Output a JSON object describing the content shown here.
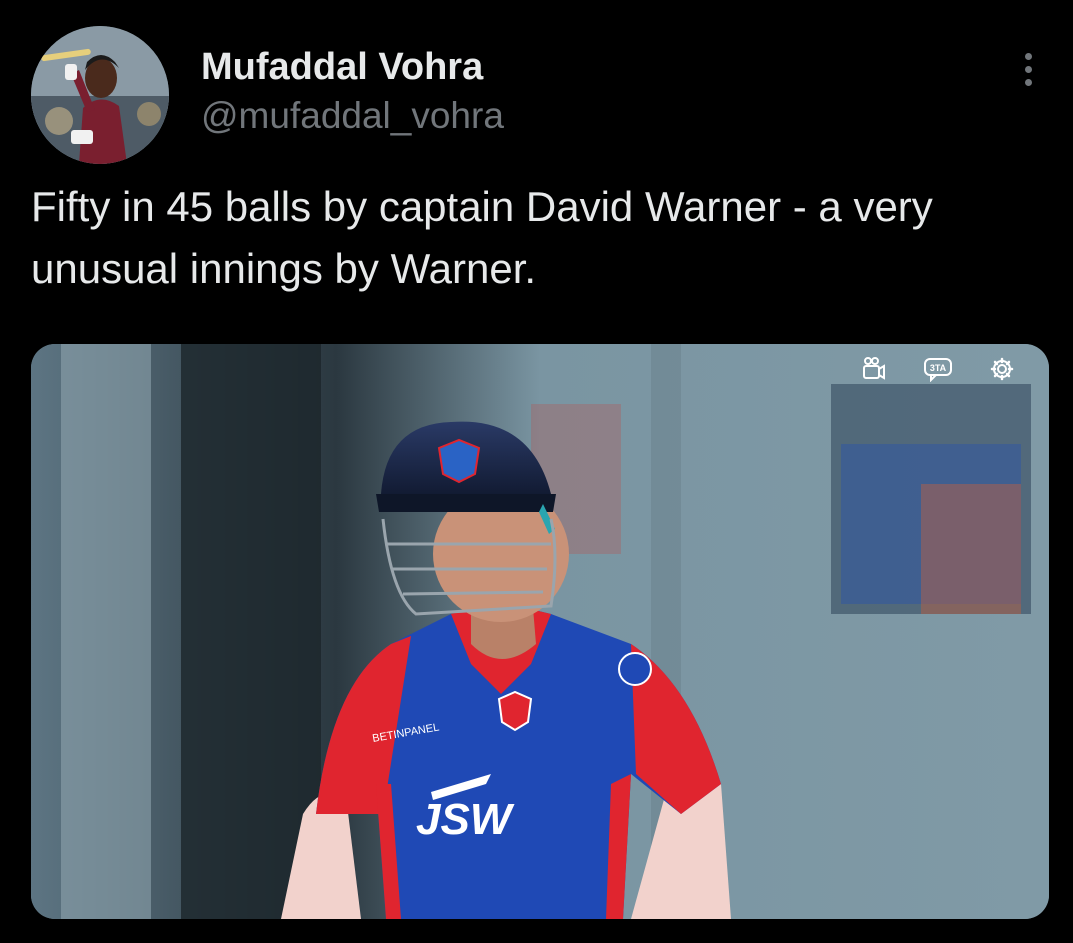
{
  "tweet": {
    "display_name": "Mufaddal Vohra",
    "handle": "@mufaddal_vohra",
    "text": "Fifty in 45 balls by captain David Warner - a very unusual innings by Warner."
  },
  "media": {
    "type": "video",
    "controls": [
      {
        "name": "video-camera-icon"
      },
      {
        "name": "caption-language-icon",
        "label": "3TA"
      },
      {
        "name": "settings-gear-icon"
      }
    ],
    "jersey_text": "JSW"
  },
  "icons": {
    "more": "more-vertical-icon"
  },
  "colors": {
    "background": "#000000",
    "primary_text": "#e7e9ea",
    "secondary_text": "#71767b",
    "jersey_blue": "#1f49b5",
    "jersey_red": "#e0252f"
  }
}
